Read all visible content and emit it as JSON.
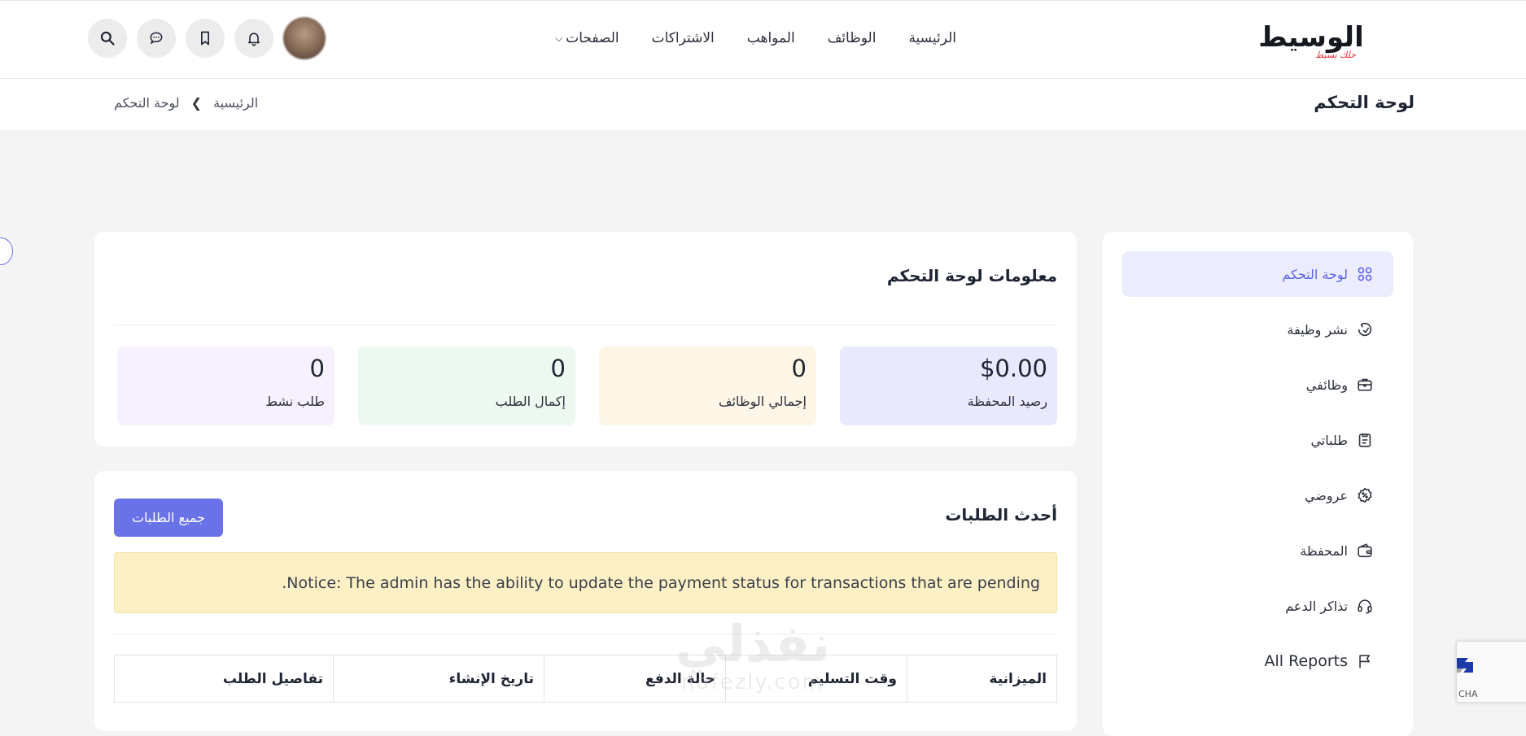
{
  "brand": {
    "name": "الوسيط",
    "tagline": "حلك بسيط"
  },
  "nav": {
    "items": [
      "الرئيسية",
      "الوظائف",
      "المواهب",
      "الاشتراكات"
    ],
    "pages_label": "الصفحات"
  },
  "header_icons": [
    "search-icon",
    "chat-icon",
    "bookmark-icon",
    "bell-icon"
  ],
  "page": {
    "title": "لوحة التحكم",
    "breadcrumb": [
      "الرئيسية",
      "لوحة التحكم"
    ]
  },
  "sidebar": {
    "items": [
      {
        "label": "لوحة التحكم",
        "icon": "grid-icon",
        "active": true
      },
      {
        "label": "نشر وظيفة",
        "icon": "post-job-icon"
      },
      {
        "label": "وظائفي",
        "icon": "briefcase-icon"
      },
      {
        "label": "طلباتي",
        "icon": "clipboard-icon"
      },
      {
        "label": "عروضي",
        "icon": "badge-percent-icon"
      },
      {
        "label": "المحفظة",
        "icon": "wallet-icon"
      },
      {
        "label": "تذاكر الدعم",
        "icon": "headset-icon"
      },
      {
        "label": "All Reports",
        "icon": "flag-icon"
      }
    ]
  },
  "dashboard_info": {
    "title": "معلومات لوحة التحكم",
    "stats": [
      {
        "value": "$0.00",
        "label": "رصيد المحفظة",
        "color": "#e9e9fd"
      },
      {
        "value": "0",
        "label": "إجمالي الوظائف",
        "color": "#fdf6e6"
      },
      {
        "value": "0",
        "label": "إكمال الطلب",
        "color": "#ecf8f0"
      },
      {
        "value": "0",
        "label": "طلب نشط",
        "color": "#f7f1fd"
      }
    ]
  },
  "orders": {
    "title": "أحدث الطلبات",
    "all_button": "جميع الطلبات",
    "notice": ".Notice: The admin has the ability to update the payment status for transactions that are pending",
    "columns": [
      "الميزانية",
      "وقت التسليم",
      "حالة الدفع",
      "تاريخ الإنشاء",
      "تفاصيل الطلب"
    ]
  },
  "watermark": {
    "ar": "نفذلي",
    "en": "nafezly.com"
  },
  "recaptcha": {
    "text": "CHA"
  },
  "colors": {
    "accent": "#6a72e8",
    "notice_bg": "#fdf0c4",
    "page_bg": "#f4f4f5"
  }
}
